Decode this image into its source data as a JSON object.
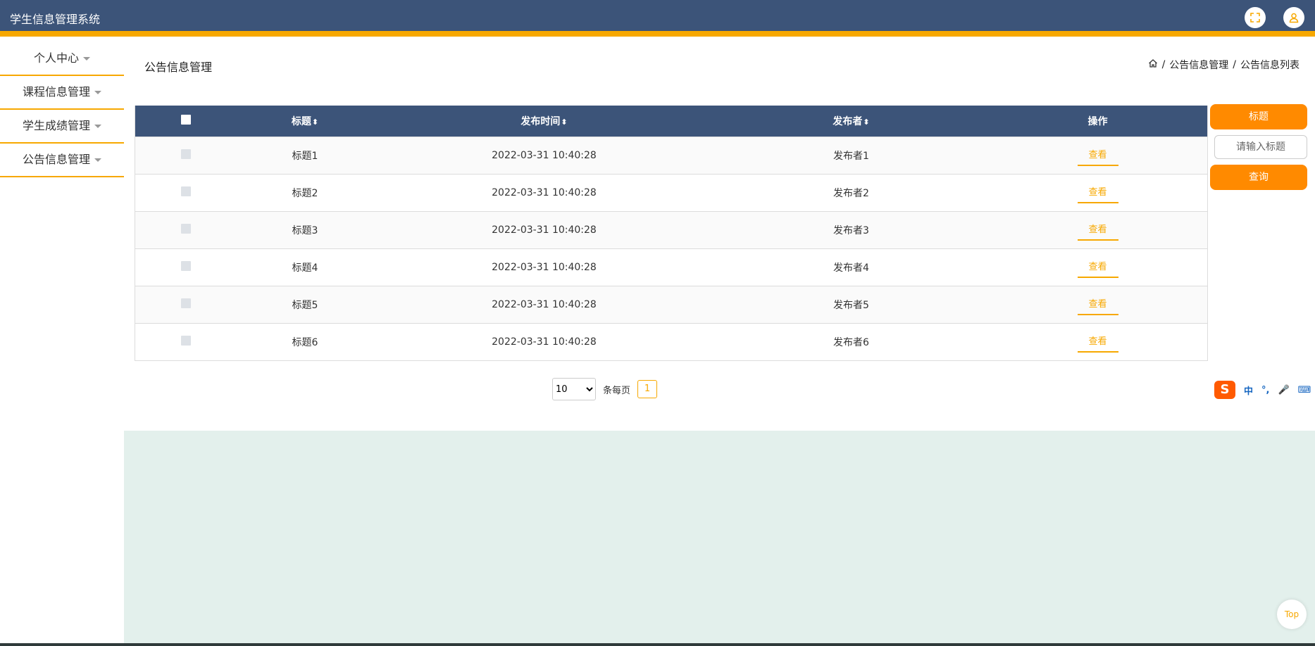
{
  "app": {
    "title": "学生信息管理系统"
  },
  "sidebar": {
    "items": [
      {
        "label": "个人中心"
      },
      {
        "label": "课程信息管理"
      },
      {
        "label": "学生成绩管理"
      },
      {
        "label": "公告信息管理"
      }
    ]
  },
  "page": {
    "title": "公告信息管理",
    "breadcrumb": [
      "公告信息管理",
      "公告信息列表"
    ],
    "breadcrumb_sep": "/"
  },
  "table": {
    "columns": {
      "title": "标题",
      "time": "发布时间",
      "publisher": "发布者",
      "action": "操作"
    },
    "rows": [
      {
        "title": "标题1",
        "time": "2022-03-31 10:40:28",
        "publisher": "发布者1",
        "action": "查看"
      },
      {
        "title": "标题2",
        "time": "2022-03-31 10:40:28",
        "publisher": "发布者2",
        "action": "查看"
      },
      {
        "title": "标题3",
        "time": "2022-03-31 10:40:28",
        "publisher": "发布者3",
        "action": "查看"
      },
      {
        "title": "标题4",
        "time": "2022-03-31 10:40:28",
        "publisher": "发布者4",
        "action": "查看"
      },
      {
        "title": "标题5",
        "time": "2022-03-31 10:40:28",
        "publisher": "发布者5",
        "action": "查看"
      },
      {
        "title": "标题6",
        "time": "2022-03-31 10:40:28",
        "publisher": "发布者6",
        "action": "查看"
      }
    ]
  },
  "search": {
    "label": "标题",
    "placeholder": "请输入标题",
    "button": "查询"
  },
  "pagination": {
    "page_size": "10",
    "page_size_options": [
      "10"
    ],
    "per_page_label": "条每页",
    "current_page": "1"
  },
  "ime": {
    "logo": "S",
    "mode": "中",
    "punct": "°,",
    "mic": "🎤",
    "keyboard": "⌨",
    "grid": "▦"
  },
  "back_to_top": "Top",
  "colors": {
    "header": "#3c5479",
    "accent": "#f7a800",
    "button": "#ff8a00",
    "content_bg": "#e3f0ec"
  },
  "icons": {
    "fullscreen": "fullscreen-icon",
    "user": "user-icon",
    "home": "home-icon",
    "sort": "sort-icon"
  }
}
